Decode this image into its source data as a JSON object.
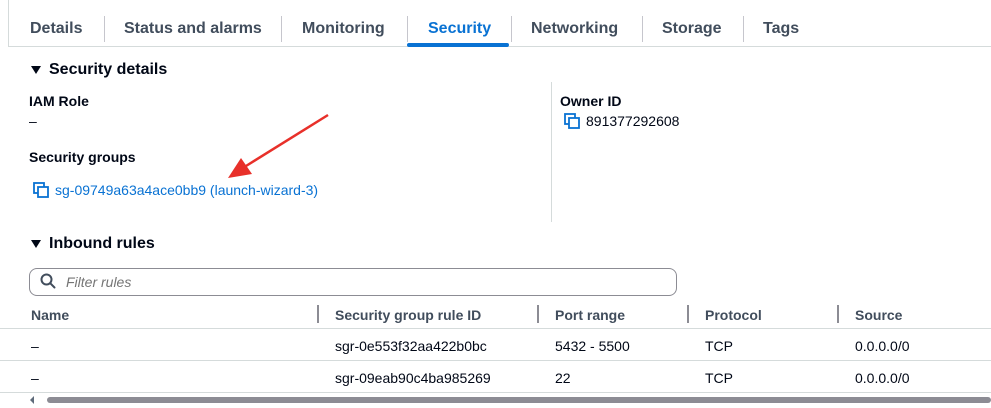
{
  "tabs": {
    "details": "Details",
    "status": "Status and alarms",
    "monitoring": "Monitoring",
    "security": "Security",
    "networking": "Networking",
    "storage": "Storage",
    "tags": "Tags"
  },
  "security_details": {
    "header": "Security details",
    "iam_role_label": "IAM Role",
    "iam_role_value": "–",
    "security_groups_label": "Security groups",
    "security_group_link": "sg-09749a63a4ace0bb9 (launch-wizard-3)",
    "owner_id_label": "Owner ID",
    "owner_id_value": "891377292608"
  },
  "inbound_rules": {
    "header": "Inbound rules",
    "filter_placeholder": "Filter rules",
    "columns": {
      "name": "Name",
      "rule_id": "Security group rule ID",
      "port_range": "Port range",
      "protocol": "Protocol",
      "source": "Source"
    },
    "rows": [
      {
        "name": "–",
        "rule_id": "sgr-0e553f32aa422b0bc",
        "port_range": "5432 - 5500",
        "protocol": "TCP",
        "source": "0.0.0.0/0"
      },
      {
        "name": "–",
        "rule_id": "sgr-09eab90c4ba985269",
        "port_range": "22",
        "protocol": "TCP",
        "source": "0.0.0.0/0"
      }
    ]
  },
  "colors": {
    "accent": "#0972d3",
    "annotation_arrow": "#e8302a"
  },
  "icons": {
    "copy": "copy-icon",
    "search": "search-icon",
    "caret": "caret-down-icon"
  }
}
